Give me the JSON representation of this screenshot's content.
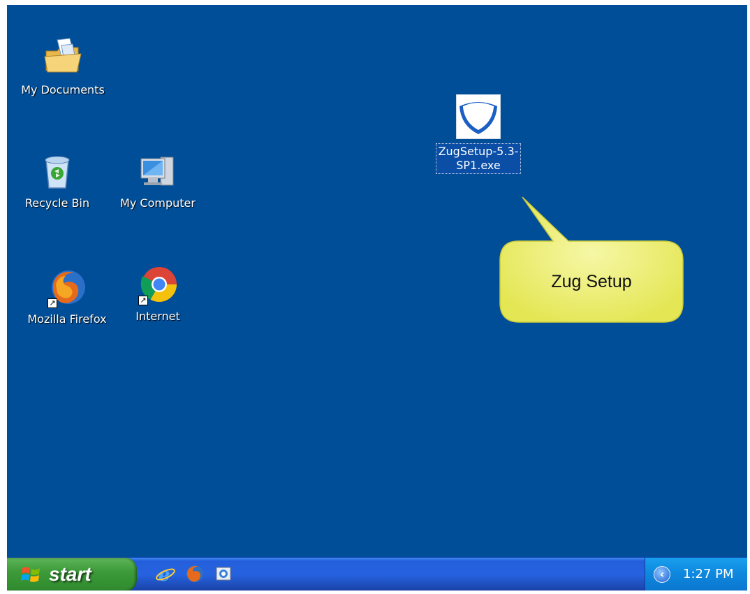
{
  "desktop": {
    "background_color": "#004e98",
    "icons": [
      {
        "label": "My Documents",
        "icon": "folder-documents-icon"
      },
      {
        "label": "Recycle Bin",
        "icon": "recycle-bin-icon"
      },
      {
        "label": "My Computer",
        "icon": "computer-icon"
      },
      {
        "label": "Mozilla Firefox",
        "icon": "firefox-icon"
      },
      {
        "label": "Internet",
        "icon": "chrome-icon"
      }
    ],
    "selected_file": {
      "label_line1": "ZugSetup-5.3-",
      "label_line2": "SP1.exe",
      "icon": "zug-setup-icon"
    }
  },
  "callout": {
    "text": "Zug Setup",
    "color": "#eef07a"
  },
  "taskbar": {
    "start_label": "start",
    "quick_launch": [
      "internet-explorer-icon",
      "firefox-icon",
      "chrome-icon"
    ],
    "clock": "1:27 PM"
  }
}
